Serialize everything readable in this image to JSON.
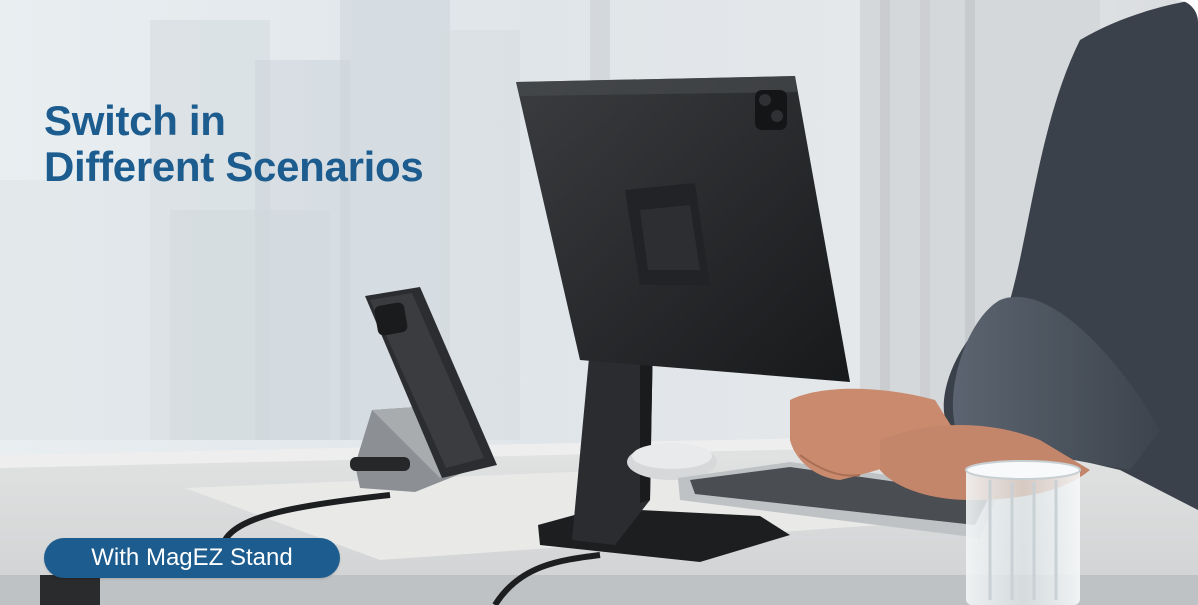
{
  "headline": {
    "line1": "Switch in",
    "line2": "Different Scenarios"
  },
  "badge": {
    "label": "With MagEZ Stand"
  },
  "colors": {
    "accent": "#1c5c8e",
    "badge_text": "#ffffff"
  }
}
